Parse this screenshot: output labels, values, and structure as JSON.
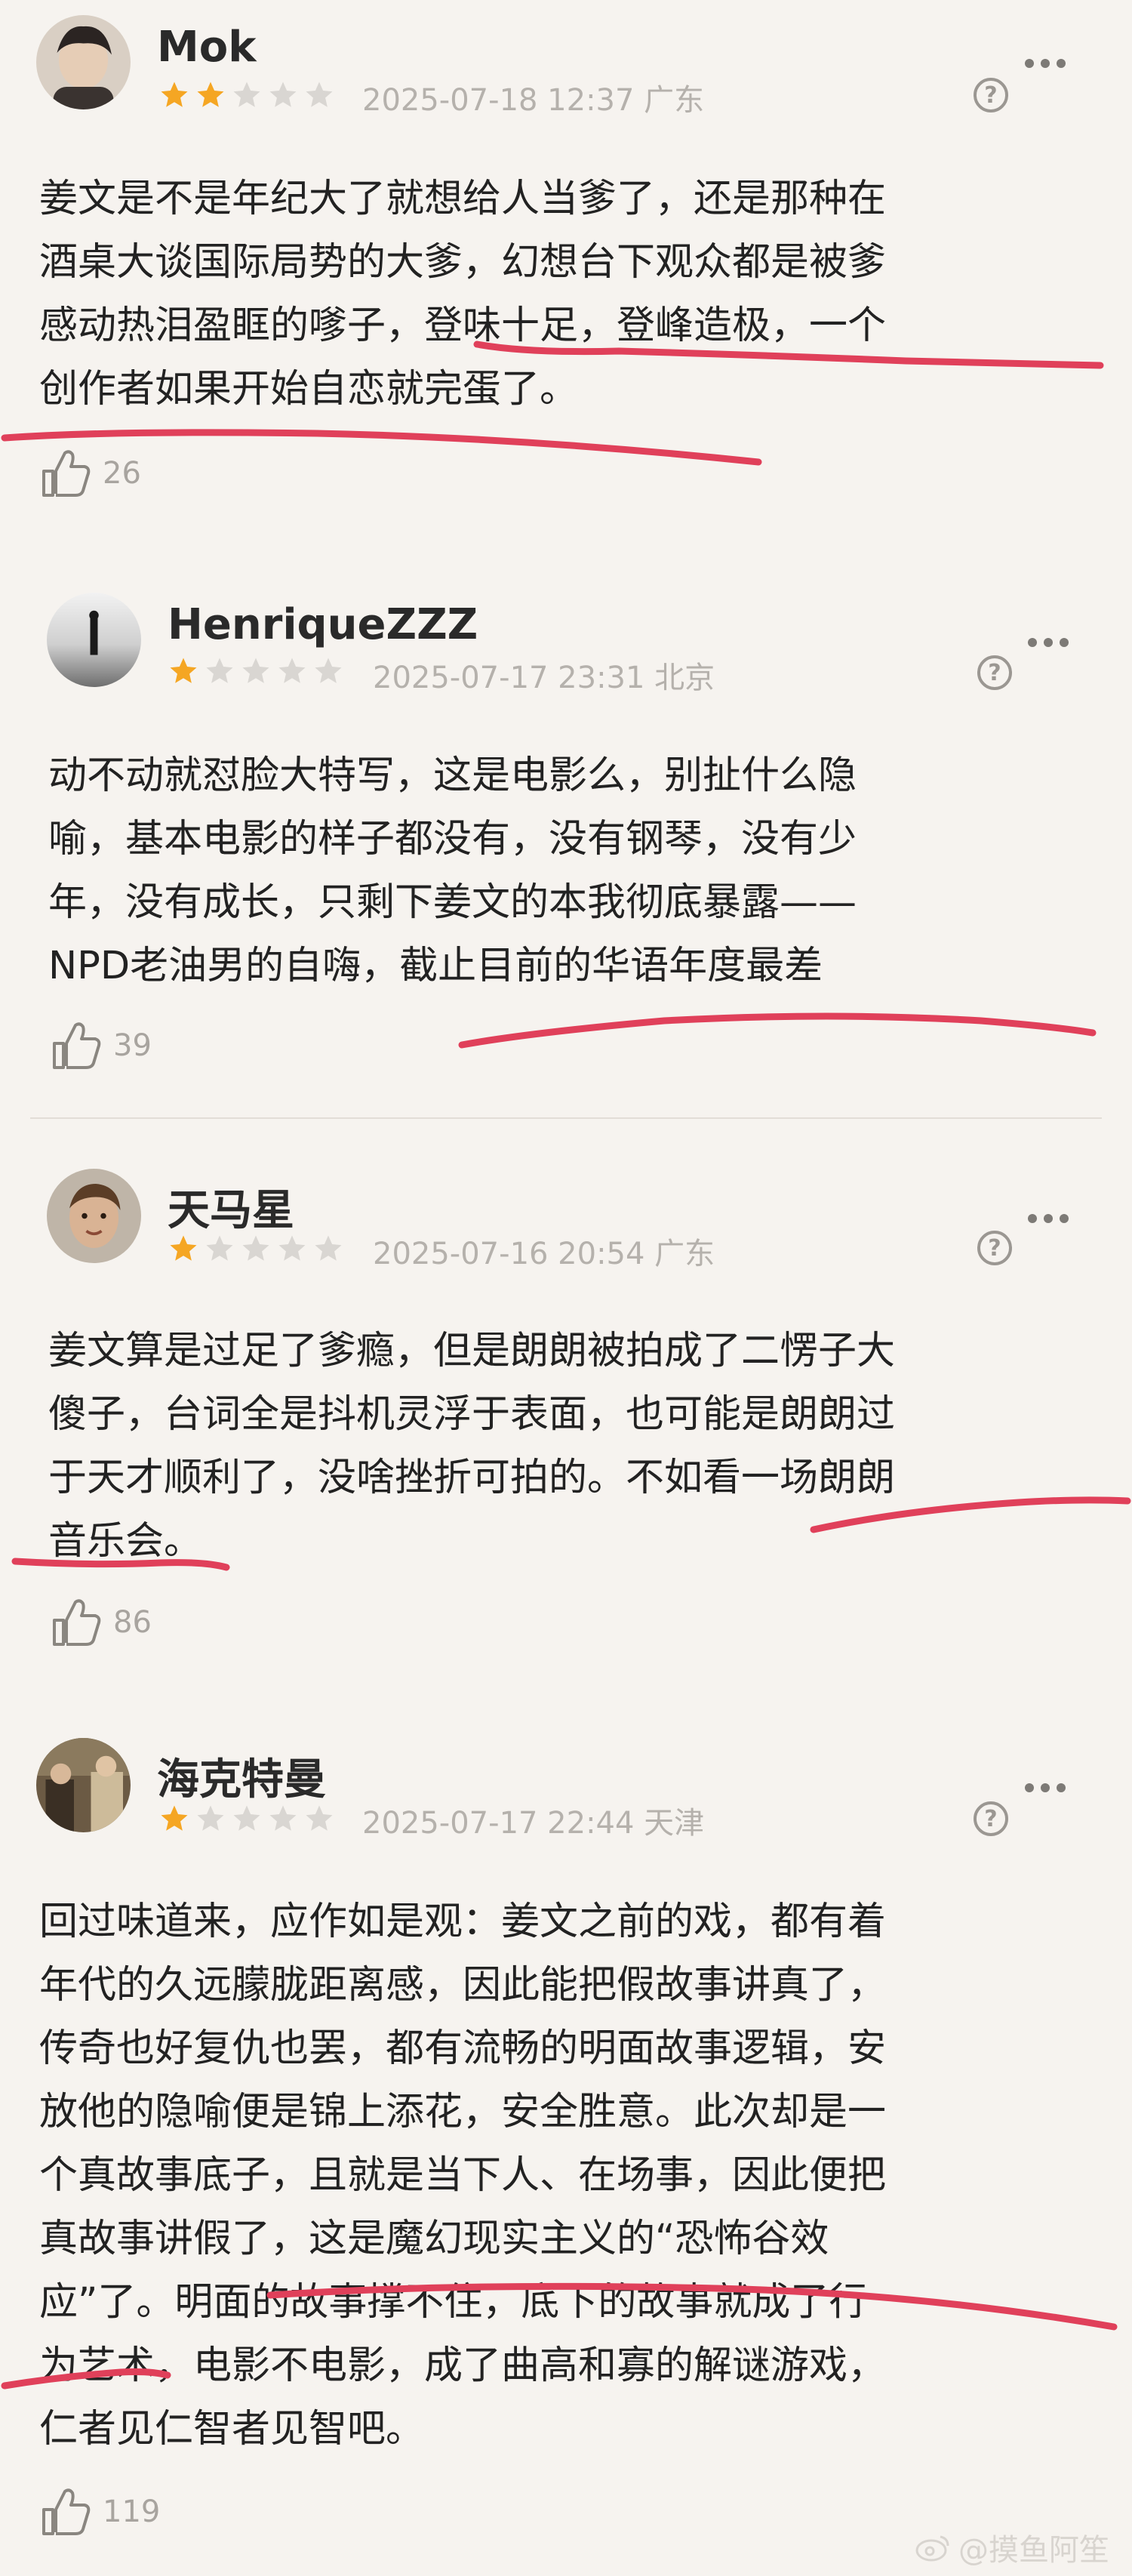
{
  "reviews": [
    {
      "username": "Mok",
      "rating": 2,
      "date": "2025-07-18 12:37",
      "location": "广东",
      "help_icon": "question-mark",
      "more_icon": "ellipsis",
      "lines": [
        "姜文是不是年纪大了就想给人当爹了，还是那种在",
        "酒桌大谈国际局势的大爹，幻想台下观众都是被爹",
        "感动热泪盈眶的嗲子，登味十足，登峰造极，一个",
        "创作者如果开始自恋就完蛋了。"
      ],
      "likes": "26"
    },
    {
      "username": "HenriqueZZZ",
      "rating": 1,
      "date": "2025-07-17 23:31",
      "location": "北京",
      "help_icon": "question-mark",
      "more_icon": "ellipsis",
      "lines": [
        "动不动就怼脸大特写，这是电影么，别扯什么隐",
        "喻，基本电影的样子都没有，没有钢琴，没有少",
        "年，没有成长，只剩下姜文的本我彻底暴露——",
        "NPD老油男的自嗨，截止目前的华语年度最差"
      ],
      "likes": "39"
    },
    {
      "username": "天马星",
      "rating": 1,
      "date": "2025-07-16 20:54",
      "location": "广东",
      "help_icon": "question-mark",
      "more_icon": "ellipsis",
      "lines": [
        "姜文算是过足了爹瘾，但是朗朗被拍成了二愣子大",
        "傻子，台词全是抖机灵浮于表面，也可能是朗朗过",
        "于天才顺利了，没啥挫折可拍的。不如看一场朗朗",
        "音乐会。"
      ],
      "likes": "86"
    },
    {
      "username": "海克特曼",
      "rating": 1,
      "date": "2025-07-17 22:44",
      "location": "天津",
      "help_icon": "question-mark",
      "more_icon": "ellipsis",
      "lines": [
        "回过味道来，应作如是观：姜文之前的戏，都有着",
        "年代的久远朦胧距离感，因此能把假故事讲真了，",
        "传奇也好复仇也罢，都有流畅的明面故事逻辑，安",
        "放他的隐喻便是锦上添花，安全胜意。此次却是一",
        "个真故事底子，且就是当下人、在场事，因此便把",
        "真故事讲假了，这是魔幻现实主义的“恐怖谷效",
        "应”了。明面的故事撑不住，底下的故事就成了行",
        "为艺术，电影不电影，成了曲高和寡的解谜游戏，",
        "仁者见仁智者见智吧。"
      ],
      "likes": "119"
    }
  ],
  "watermark": "@摸鱼阿笙",
  "colors": {
    "background": "#f6f3ef",
    "star_filled": "#f5a623",
    "star_empty": "#d9d6d2",
    "underline": "#e0405a"
  }
}
